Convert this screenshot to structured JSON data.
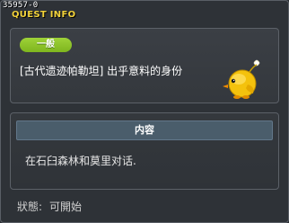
{
  "window": {
    "id": "35957-0",
    "title": "QUEST INFO"
  },
  "quest": {
    "category": "一般",
    "name": "[古代遗迹帕勒坦] 出乎意料的身份",
    "mascot_icon": "yellow-creature-icon"
  },
  "content": {
    "header": "内容",
    "text": "在石臼森林和莫里对话."
  },
  "status": {
    "label": "狀態:",
    "value": "可開始"
  },
  "colors": {
    "title": "#f2d23a",
    "badge": "#8cc425",
    "header": "#4a5d6b"
  }
}
